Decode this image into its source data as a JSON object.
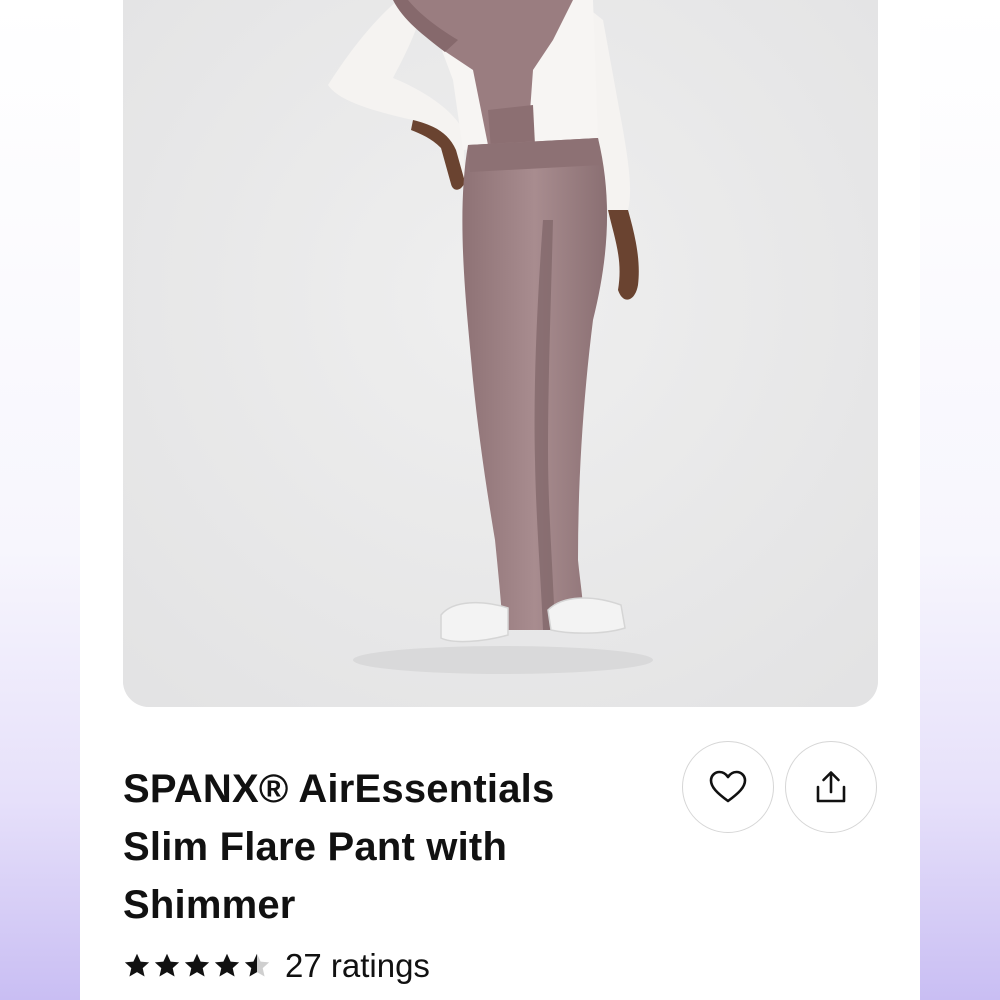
{
  "product": {
    "title_line1": "SPANX® AirEssentials",
    "title_line2": "Slim Flare Pant with",
    "title_line3": "Shimmer",
    "image": {
      "subject": "model-wearing-flare-pants",
      "background_color": "#e9e9ea",
      "pant_color": "#9c8083"
    }
  },
  "actions": {
    "favorite_icon": "heart-icon",
    "share_icon": "share-icon"
  },
  "rating": {
    "stars_value": 4.5,
    "stars_max": 5,
    "count_label": "27 ratings"
  },
  "colors": {
    "text": "#111111",
    "button_border": "#d6d6d6",
    "star": "#111111"
  }
}
